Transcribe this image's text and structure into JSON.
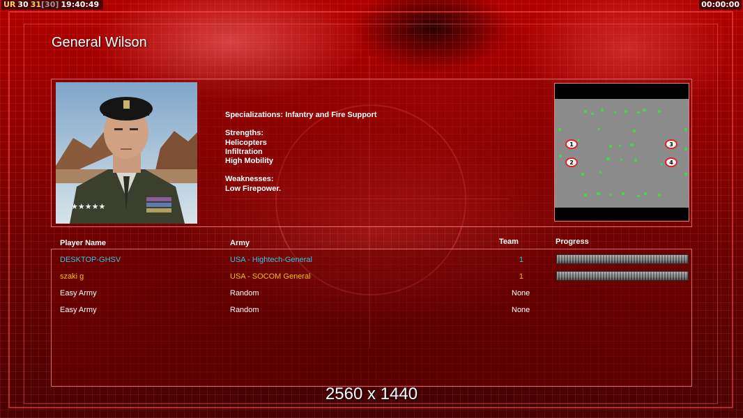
{
  "hud": {
    "left": [
      {
        "text": "UR",
        "color": "#ffd25a"
      },
      {
        "text": "30",
        "color": "#ffffff"
      },
      {
        "text": "31",
        "color": "#ffd25a"
      },
      {
        "text": "[30]",
        "color": "#9a9a9a"
      },
      {
        "text": "19:40:49",
        "color": "#ffffff"
      }
    ],
    "right": "00:00:00"
  },
  "general_title": "General Wilson",
  "description": {
    "specializations": "Specializations: Infantry and Fire Support",
    "strengths_label": "Strengths:",
    "strengths": [
      "Helicopters",
      "Infiltration",
      "High Mobility"
    ],
    "weaknesses_label": "Weaknesses:",
    "weaknesses": [
      "Low Firepower."
    ]
  },
  "minimap": {
    "start_positions": [
      "1",
      "2",
      "3",
      "4"
    ]
  },
  "table": {
    "headers": {
      "player_name": "Player Name",
      "army": "Army",
      "team": "Team",
      "progress": "Progress"
    },
    "rows": [
      {
        "player": "DESKTOP-GHSV",
        "army": "USA - Hightech-General",
        "team": "1",
        "color": "#33c6e8",
        "has_progress": true
      },
      {
        "player": "szaki g",
        "army": "USA - SOCOM General",
        "team": "1",
        "color": "#f2c200",
        "has_progress": true
      },
      {
        "player": "Easy Army",
        "army": "Random",
        "team": "None",
        "color": "#ffffff",
        "has_progress": false
      },
      {
        "player": "Easy Army",
        "army": "Random",
        "team": "None",
        "color": "#ffffff",
        "has_progress": false
      }
    ]
  },
  "resolution_label": "2560 x 1440",
  "colors": {
    "background": "#8c0000",
    "panel_border": "#ff8c8c",
    "player_1": "#33c6e8",
    "player_2": "#f2c200"
  }
}
